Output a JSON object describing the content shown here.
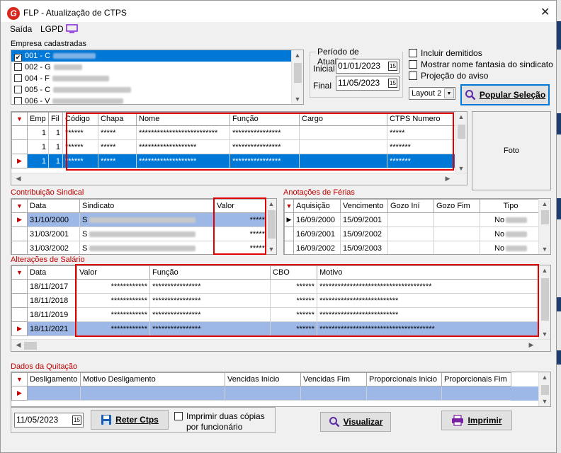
{
  "window": {
    "title": "FLP - Atualização de CTPS",
    "logo": "G",
    "close": "✕"
  },
  "menu": {
    "saida": "Saída",
    "lgpd": "LGPD"
  },
  "empresas": {
    "label": "Empresa cadastradas",
    "items": [
      {
        "code": "001 - C",
        "checked": true,
        "selected": true
      },
      {
        "code": "002 - G",
        "checked": false
      },
      {
        "code": "004 - F",
        "checked": false
      },
      {
        "code": "005 - C",
        "checked": false
      },
      {
        "code": "006 - V",
        "checked": false
      }
    ]
  },
  "periodo": {
    "legend": "Período de Atualização",
    "inicial_label": "Inicial",
    "inicial": "01/01/2023",
    "final_label": "Final",
    "final": "11/05/2023"
  },
  "options": {
    "incluir_demitidos": "Incluir demitidos",
    "mostrar_nome": "Mostrar nome fantasia do sindicato",
    "projecao": "Projeção do aviso",
    "layout": "Layout 2",
    "popular": "Popular Seleção"
  },
  "employees": {
    "columns": [
      "Emp",
      "Fil",
      "Código",
      "Chapa",
      "Nome",
      "Função",
      "Cargo",
      "CTPS Numero"
    ],
    "rows": [
      [
        "1",
        "1",
        "******",
        "*****",
        "**************************",
        "****************",
        "",
        "*****"
      ],
      [
        "1",
        "1",
        "******",
        "*****",
        "*******************",
        "****************",
        "",
        "*******"
      ],
      [
        "1",
        "1",
        "******",
        "*****",
        "*******************",
        "****************",
        "",
        "*******"
      ]
    ],
    "foto": "Foto"
  },
  "contribuicao": {
    "label": "Contribuição Sindical",
    "columns": [
      "Data",
      "Sindicato",
      "Valor"
    ],
    "rows": [
      [
        "31/10/2000",
        "S",
        "*****"
      ],
      [
        "31/03/2001",
        "S",
        "*****"
      ],
      [
        "31/03/2002",
        "S",
        "*****"
      ]
    ]
  },
  "ferias": {
    "label": "Anotações de Férias",
    "columns": [
      "Aquisição",
      "Vencimento",
      "Gozo Iní",
      "Gozo Fim",
      "Tipo"
    ],
    "rows": [
      [
        "16/09/2000",
        "15/09/2001",
        "",
        "",
        "No"
      ],
      [
        "16/09/2001",
        "15/09/2002",
        "",
        "",
        "No"
      ],
      [
        "16/09/2002",
        "15/09/2003",
        "",
        "",
        "No"
      ]
    ]
  },
  "salario": {
    "label": "Alterações de Salário",
    "columns": [
      "Data",
      "Valor",
      "Função",
      "CBO",
      "Motivo"
    ],
    "rows": [
      [
        "18/11/2017",
        "************",
        "****************",
        "******",
        "*************************************"
      ],
      [
        "18/11/2018",
        "************",
        "****************",
        "******",
        "**************************"
      ],
      [
        "18/11/2019",
        "************",
        "****************",
        "******",
        "**************************"
      ],
      [
        "18/11/2021",
        "************",
        "****************",
        "******",
        "**************************************"
      ]
    ]
  },
  "quitacao": {
    "label": "Dados da Quitação",
    "columns": [
      "Desligamento",
      "Motivo Desligamento",
      "Vencidas Inicio",
      "Vencidas Fim",
      "Proporcionais Inicio",
      "Proporcionais Fim"
    ]
  },
  "footer": {
    "date": "11/05/2023",
    "reter": "Reter Ctps",
    "imprimir_duas": "Imprimir duas cópias",
    "por_funcionario": "por funcionário",
    "visualizar": "Visualizar",
    "imprimir": "Imprimir"
  },
  "colors": {
    "selection": "#0078d7",
    "highlight": "#9db8e6",
    "red": "#e00000",
    "label_red": "#c00000"
  }
}
